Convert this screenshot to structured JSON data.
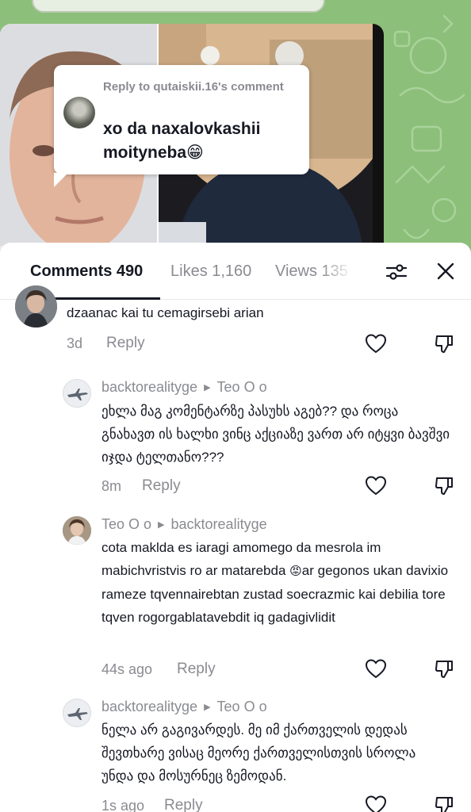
{
  "video": {
    "reply_bubble": {
      "reply_to": "Reply to qutaiskii.16's comment",
      "text": "xo da naxalovkashii moityneba",
      "emoji": "😁"
    }
  },
  "tabs": {
    "comments": "Comments 490",
    "likes": "Likes 1,160",
    "views": "Views 135"
  },
  "icons": {
    "filter": "sliders-icon",
    "close": "close-icon",
    "like": "heart-icon",
    "dislike": "thumbs-down-icon"
  },
  "comments": [
    {
      "text": "dzaanac kai tu cemagirsebi arian",
      "time": "3d",
      "reply": "Reply"
    },
    {
      "username": "backtorealityge",
      "reply_to": "Teo O o",
      "text": "ეხლა მაგ კომენტარზე პასუხს აგებ?? და როცა გნახავთ ის ხალხი ვინც აქციაზე ვართ არ იტყვი ბავშვი იჯდა ტელთანო???",
      "time": "8m",
      "reply": "Reply"
    },
    {
      "username": "Teo O o",
      "reply_to": "backtorealityge",
      "text": "cota maklda es iaragi amomego da mesrola im mabichvristvis ro ar matarebda",
      "emoji": "😡",
      "text2": "ar gegonos ukan davixio rameze tqvennairebtan zustad soecrazmic kai debilia tore tqven rogorgablatavebdit iq gadagivlidit",
      "time": "44s ago",
      "reply": "Reply"
    },
    {
      "username": "backtorealityge",
      "reply_to": "Teo O o",
      "text": "ნელა არ გაგივარდეს. მე იმ ქართველის დედას შევთხარე ვისაც მეორე ქართველისთვის სროლა უნდა და მოსურნეც ზემოდან.",
      "time": "1s ago",
      "reply": "Reply"
    }
  ],
  "colors": {
    "background_green": "#8cbf7a",
    "text_primary": "#161823",
    "text_secondary": "#8a8b91"
  }
}
